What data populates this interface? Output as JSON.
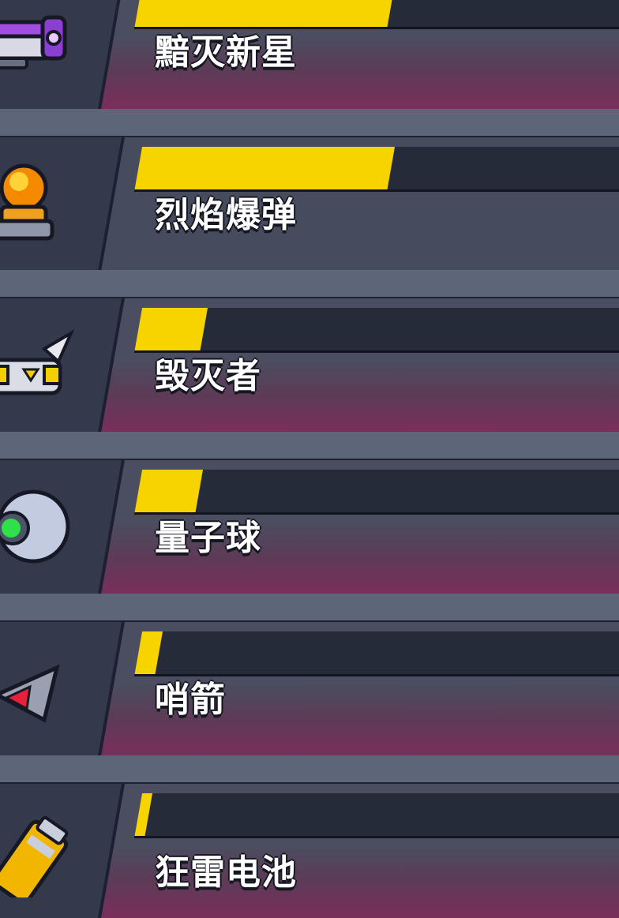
{
  "skills": [
    {
      "name": "黯灭新星",
      "progress": 0.45,
      "icon": "purple-blaster-icon",
      "card_style": "pink"
    },
    {
      "name": "烈焰爆弹",
      "progress": 0.45,
      "icon": "fire-bomb-icon",
      "card_style": "gray"
    },
    {
      "name": "毁灭者",
      "progress": 0.12,
      "icon": "destroyer-drone-icon",
      "card_style": "pink"
    },
    {
      "name": "量子球",
      "progress": 0.11,
      "icon": "quantum-orb-icon",
      "card_style": "pink"
    },
    {
      "name": "哨箭",
      "progress": 0.05,
      "icon": "sentry-arrow-icon",
      "card_style": "pink"
    },
    {
      "name": "狂雷电池",
      "progress": 0.02,
      "icon": "thunder-battery-icon",
      "card_style": "pink"
    }
  ],
  "colors": {
    "progress_fill": "#f7d300",
    "progress_track": "#262b39",
    "background": "#5a6275"
  }
}
